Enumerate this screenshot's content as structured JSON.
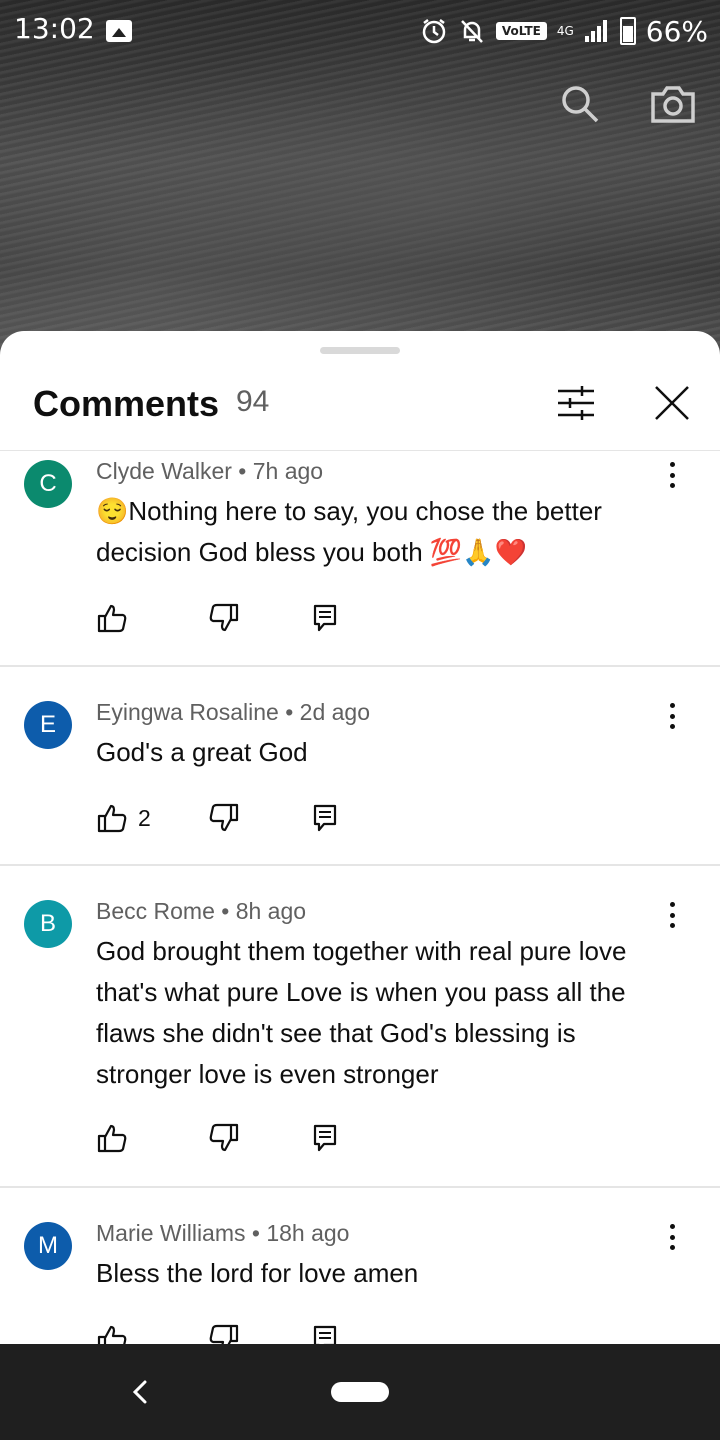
{
  "status_bar": {
    "time": "13:02",
    "volte": "VoLTE",
    "network": "4G",
    "battery": "66%"
  },
  "sheet": {
    "title": "Comments",
    "count": "94"
  },
  "comments": [
    {
      "initial": "C",
      "avatar_color": "#0b8a6e",
      "meta": "Clyde Walker • 7h ago",
      "text": "😌Nothing here to say, you chose the better decision God bless you both 💯🙏❤️",
      "likes": ""
    },
    {
      "initial": "E",
      "avatar_color": "#0d5cab",
      "meta": "Eyingwa Rosaline • 2d ago",
      "text": "God's a great God",
      "likes": "2"
    },
    {
      "initial": "B",
      "avatar_color": "#0e9aa7",
      "meta": "Becc Rome • 8h ago",
      "text": "God brought them together with real pure love that's what pure Love is when you pass all the flaws she didn't see that God's blessing is stronger love is even stronger",
      "likes": ""
    },
    {
      "initial": "M",
      "avatar_color": "#0d5cab",
      "meta": "Marie Williams • 18h ago",
      "text": "Bless the lord for love amen",
      "likes": ""
    }
  ],
  "icons": {
    "search": "search-icon",
    "camera": "camera-icon",
    "filter": "filter-icon",
    "close": "close-icon",
    "like": "thumbs-up-icon",
    "dislike": "thumbs-down-icon",
    "reply": "reply-icon",
    "more": "more-vert-icon",
    "back": "back-icon"
  }
}
